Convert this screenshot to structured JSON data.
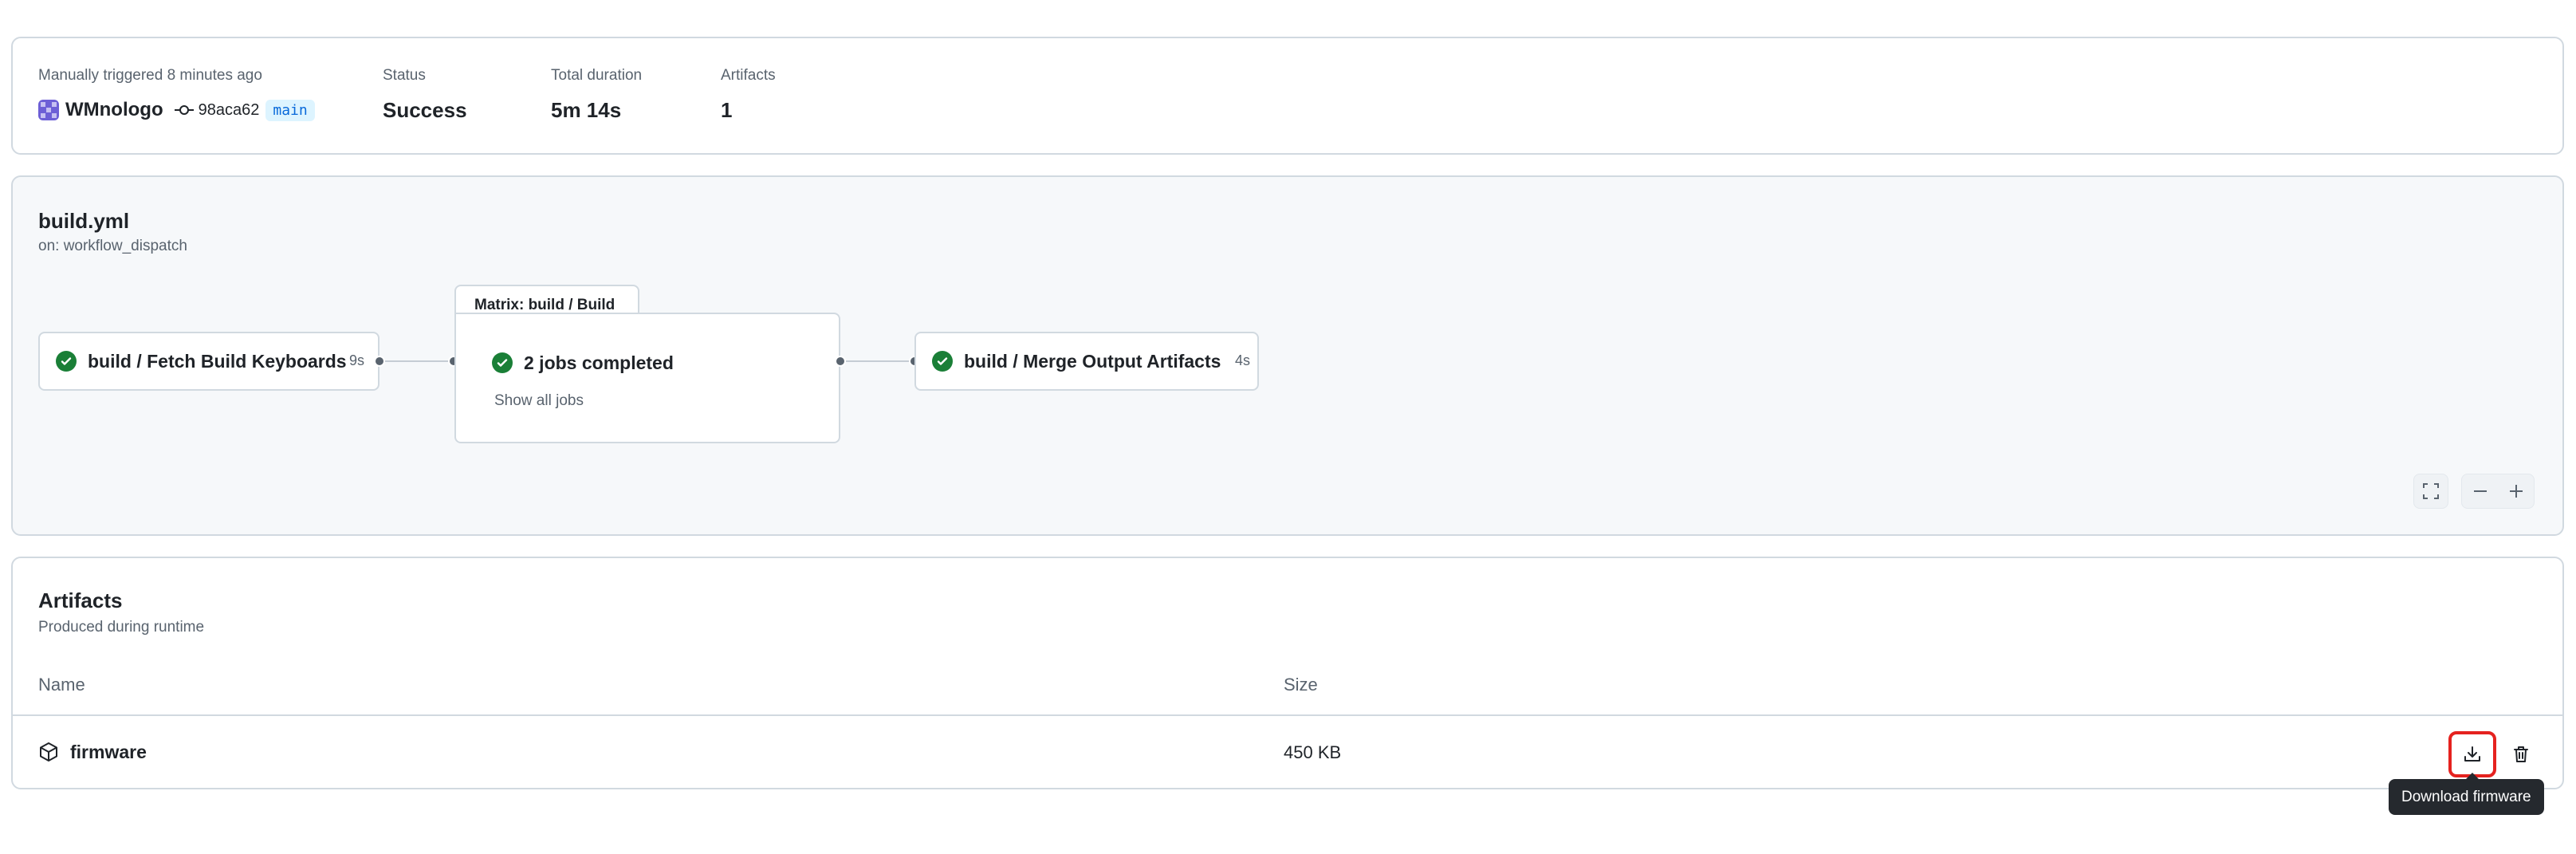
{
  "summary": {
    "trigger_label": "Manually triggered 8 minutes ago",
    "actor": "WMnologo",
    "commit_sha": "98aca62",
    "branch": "main",
    "status_label": "Status",
    "status_value": "Success",
    "duration_label": "Total duration",
    "duration_value": "5m 14s",
    "artifacts_label": "Artifacts",
    "artifacts_value": "1"
  },
  "workflow": {
    "file": "build.yml",
    "trigger": "on: workflow_dispatch",
    "jobs": [
      {
        "name": "build / Fetch Build Keyboards",
        "duration": "9s",
        "status": "success"
      },
      {
        "matrix_label": "Matrix: build / Build",
        "summary": "2 jobs completed",
        "link": "Show all jobs",
        "status": "success"
      },
      {
        "name": "build / Merge Output Artifacts",
        "duration": "4s",
        "status": "success"
      }
    ],
    "controls": [
      "fullscreen-icon",
      "zoom-out-icon",
      "zoom-in-icon"
    ]
  },
  "artifacts": {
    "title": "Artifacts",
    "subtitle": "Produced during runtime",
    "columns": [
      "Name",
      "Size"
    ],
    "rows": [
      {
        "name": "firmware",
        "size": "450 KB"
      }
    ],
    "tooltip": "Download firmware"
  },
  "colors": {
    "success": "#1a7f37",
    "branch_bg": "#ddf4ff",
    "branch_fg": "#0969da",
    "focus_ring": "#e5221f",
    "tooltip_bg": "#25292e"
  }
}
